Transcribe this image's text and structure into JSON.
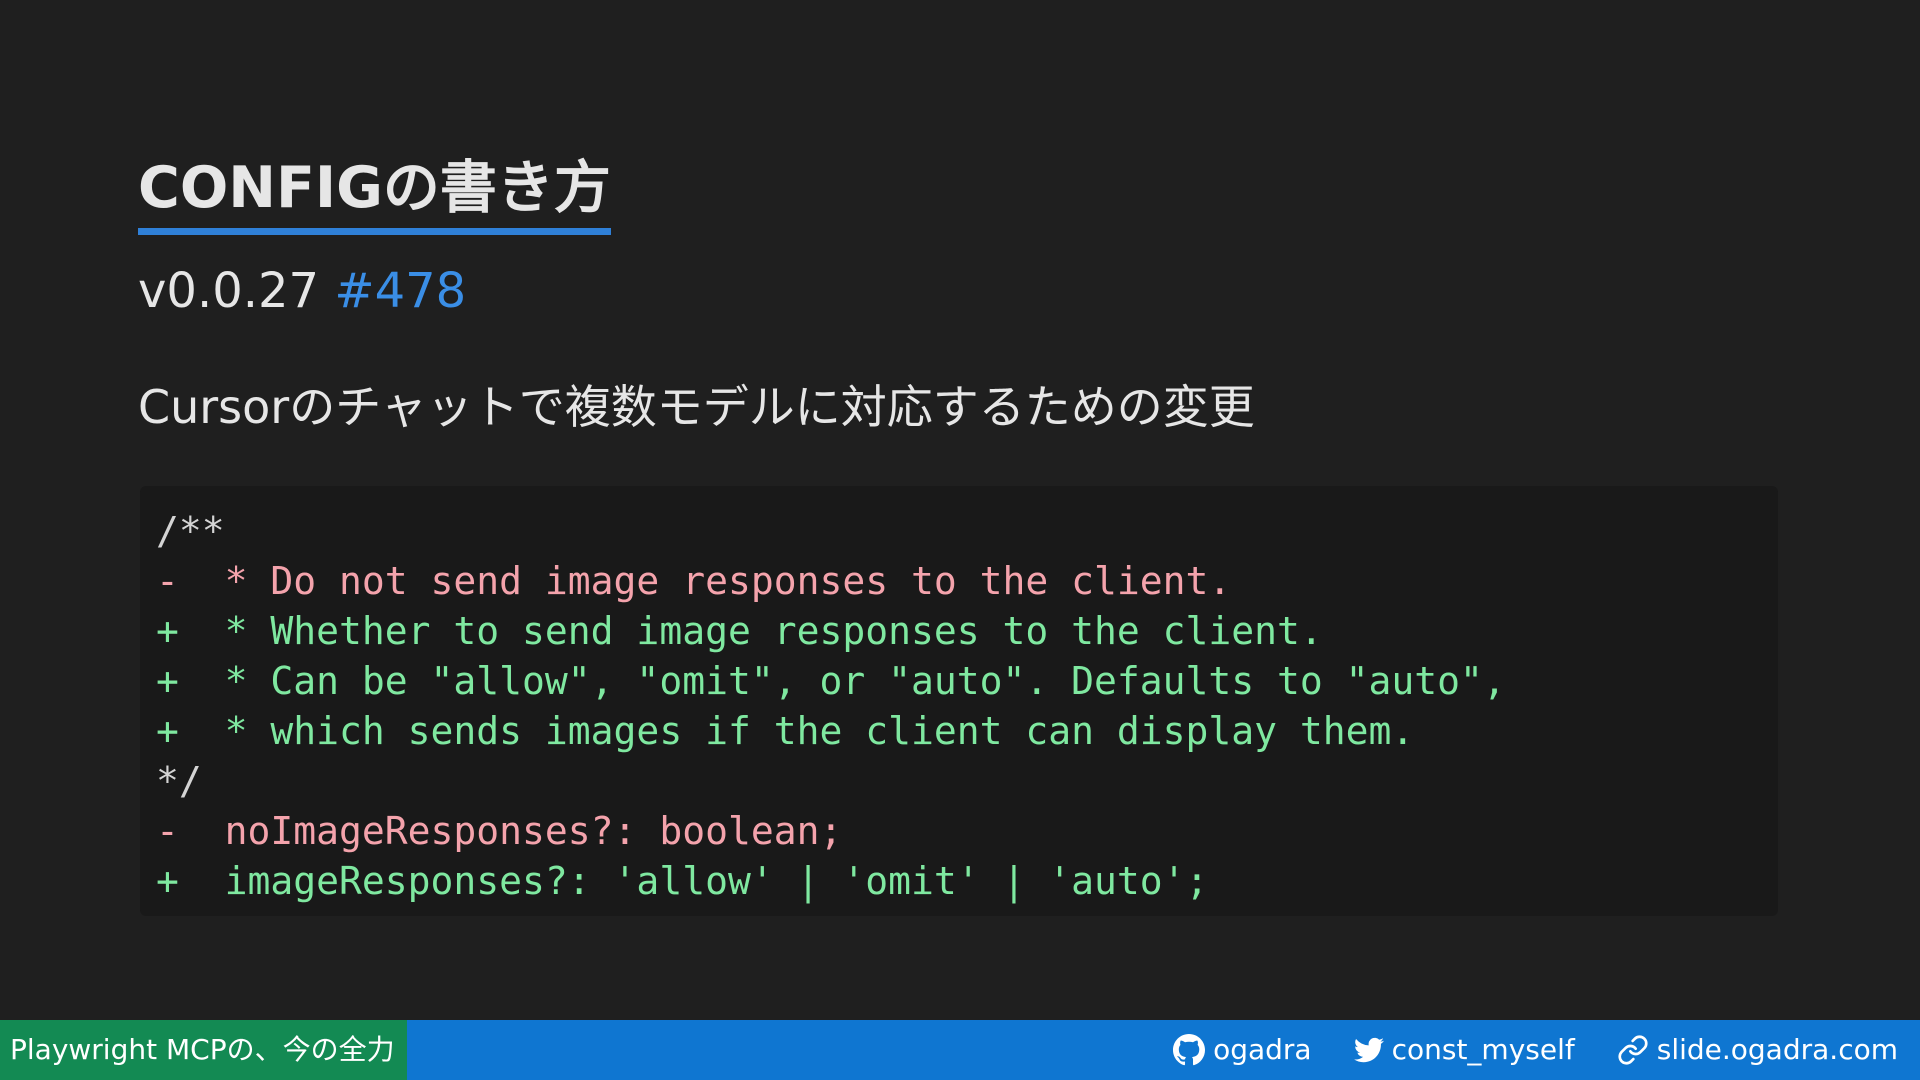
{
  "slide": {
    "title": "CONFIGの書き方",
    "version": "v0.0.27",
    "pr_link": "#478",
    "description": "Cursorのチャットで複数モデルに対応するための変更",
    "code_lines": [
      {
        "type": "ctx",
        "text": "/**"
      },
      {
        "type": "del",
        "text": "-  * Do not send image responses to the client."
      },
      {
        "type": "add",
        "text": "+  * Whether to send image responses to the client."
      },
      {
        "type": "add",
        "text": "+  * Can be \"allow\", \"omit\", or \"auto\". Defaults to \"auto\","
      },
      {
        "type": "add",
        "text": "+  * which sends images if the client can display them."
      },
      {
        "type": "ctx",
        "text": "*/"
      },
      {
        "type": "del",
        "text": "-  noImageResponses?: boolean;"
      },
      {
        "type": "add",
        "text": "+  imageResponses?: 'allow' | 'omit' | 'auto';"
      }
    ]
  },
  "footer": {
    "deck_title": "Playwright MCPの、今の全力",
    "github_icon": "github-icon",
    "github": "ogadra",
    "twitter_icon": "twitter-icon",
    "twitter": "const_myself",
    "link_icon": "link-icon",
    "site": "slide.ogadra.com"
  },
  "colors": {
    "background": "#1f1f1f",
    "code_background": "#191919",
    "accent": "#2f80d8",
    "link": "#3a8ee6",
    "diff_removed": "#f4a3ac",
    "diff_added": "#7fe8a0",
    "footer_bar": "#0f76d1",
    "footer_title_bg": "#138a53"
  }
}
